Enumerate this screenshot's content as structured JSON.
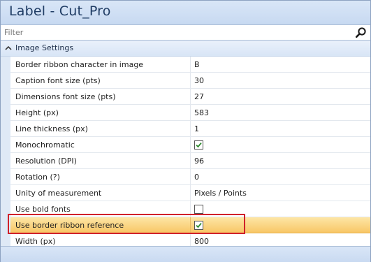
{
  "window": {
    "title": "Label - Cut_Pro"
  },
  "filter": {
    "placeholder": "Filter",
    "value": ""
  },
  "category": {
    "label": "Image Settings",
    "expanded": true
  },
  "properties": [
    {
      "name": "Border ribbon character in image",
      "type": "text",
      "value": "B"
    },
    {
      "name": "Caption font size (pts)",
      "type": "text",
      "value": "30"
    },
    {
      "name": "Dimensions font size (pts)",
      "type": "text",
      "value": "27"
    },
    {
      "name": "Height (px)",
      "type": "text",
      "value": "583"
    },
    {
      "name": "Line thickness (px)",
      "type": "text",
      "value": "1"
    },
    {
      "name": "Monochromatic",
      "type": "checkbox",
      "checked": true
    },
    {
      "name": "Resolution (DPI)",
      "type": "text",
      "value": "96"
    },
    {
      "name": "Rotation (?)",
      "type": "text",
      "value": "0"
    },
    {
      "name": "Unity of measurement",
      "type": "text",
      "value": "Pixels / Points"
    },
    {
      "name": "Use bold fonts",
      "type": "checkbox",
      "checked": false
    },
    {
      "name": "Use border ribbon reference",
      "type": "checkbox",
      "checked": true,
      "selected": true
    },
    {
      "name": "Width (px)",
      "type": "text",
      "value": "800"
    }
  ],
  "colors": {
    "selection_row": "#f8c563",
    "highlight_box": "#d0202a",
    "checkmark": "#2e8b2e"
  },
  "icons": {
    "search": "magnifier-icon",
    "collapse": "chevron-down-icon",
    "check": "checkmark-icon"
  }
}
